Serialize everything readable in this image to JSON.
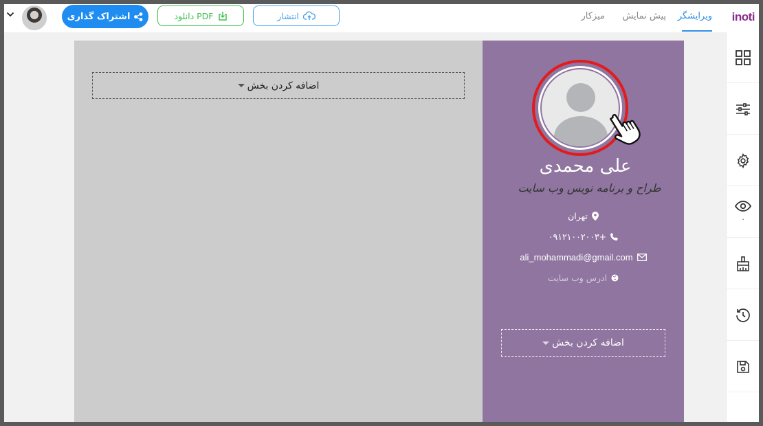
{
  "brand": {
    "logo": "inoti"
  },
  "tabs": [
    {
      "label": "ویرایشگر",
      "active": true
    },
    {
      "label": "پیش نمایش",
      "active": false
    },
    {
      "label": "میزکار",
      "active": false
    }
  ],
  "toolbar": {
    "share_label": "اشتراک گذاری",
    "pdf_label": "دانلود PDF",
    "publish_label": "انتشار"
  },
  "sidebar": {
    "items": [
      {
        "icon": "layout-grid-icon"
      },
      {
        "icon": "sliders-icon"
      },
      {
        "icon": "gear-icon"
      },
      {
        "icon": "eye-icon",
        "count": "۰"
      },
      {
        "icon": "brush-icon"
      },
      {
        "icon": "history-icon"
      },
      {
        "icon": "save-icon"
      }
    ]
  },
  "resume": {
    "add_section_label": "اضافه کردن بخش",
    "name": "علی محمدی",
    "job_title": "طراح و برنامه نویس وب سایت",
    "location": "تهران",
    "phone": "۰۹۱۲۱۰۰۲۰۰۳+",
    "email": "ali_mohammadi@gmail.com",
    "website_placeholder": "ادرس وب سایت"
  },
  "colors": {
    "accent": "#1e8cf0",
    "pdf_green": "#3bbf4a",
    "sidebar_purple": "#8f759f",
    "highlight_ring": "#e41b1b"
  }
}
